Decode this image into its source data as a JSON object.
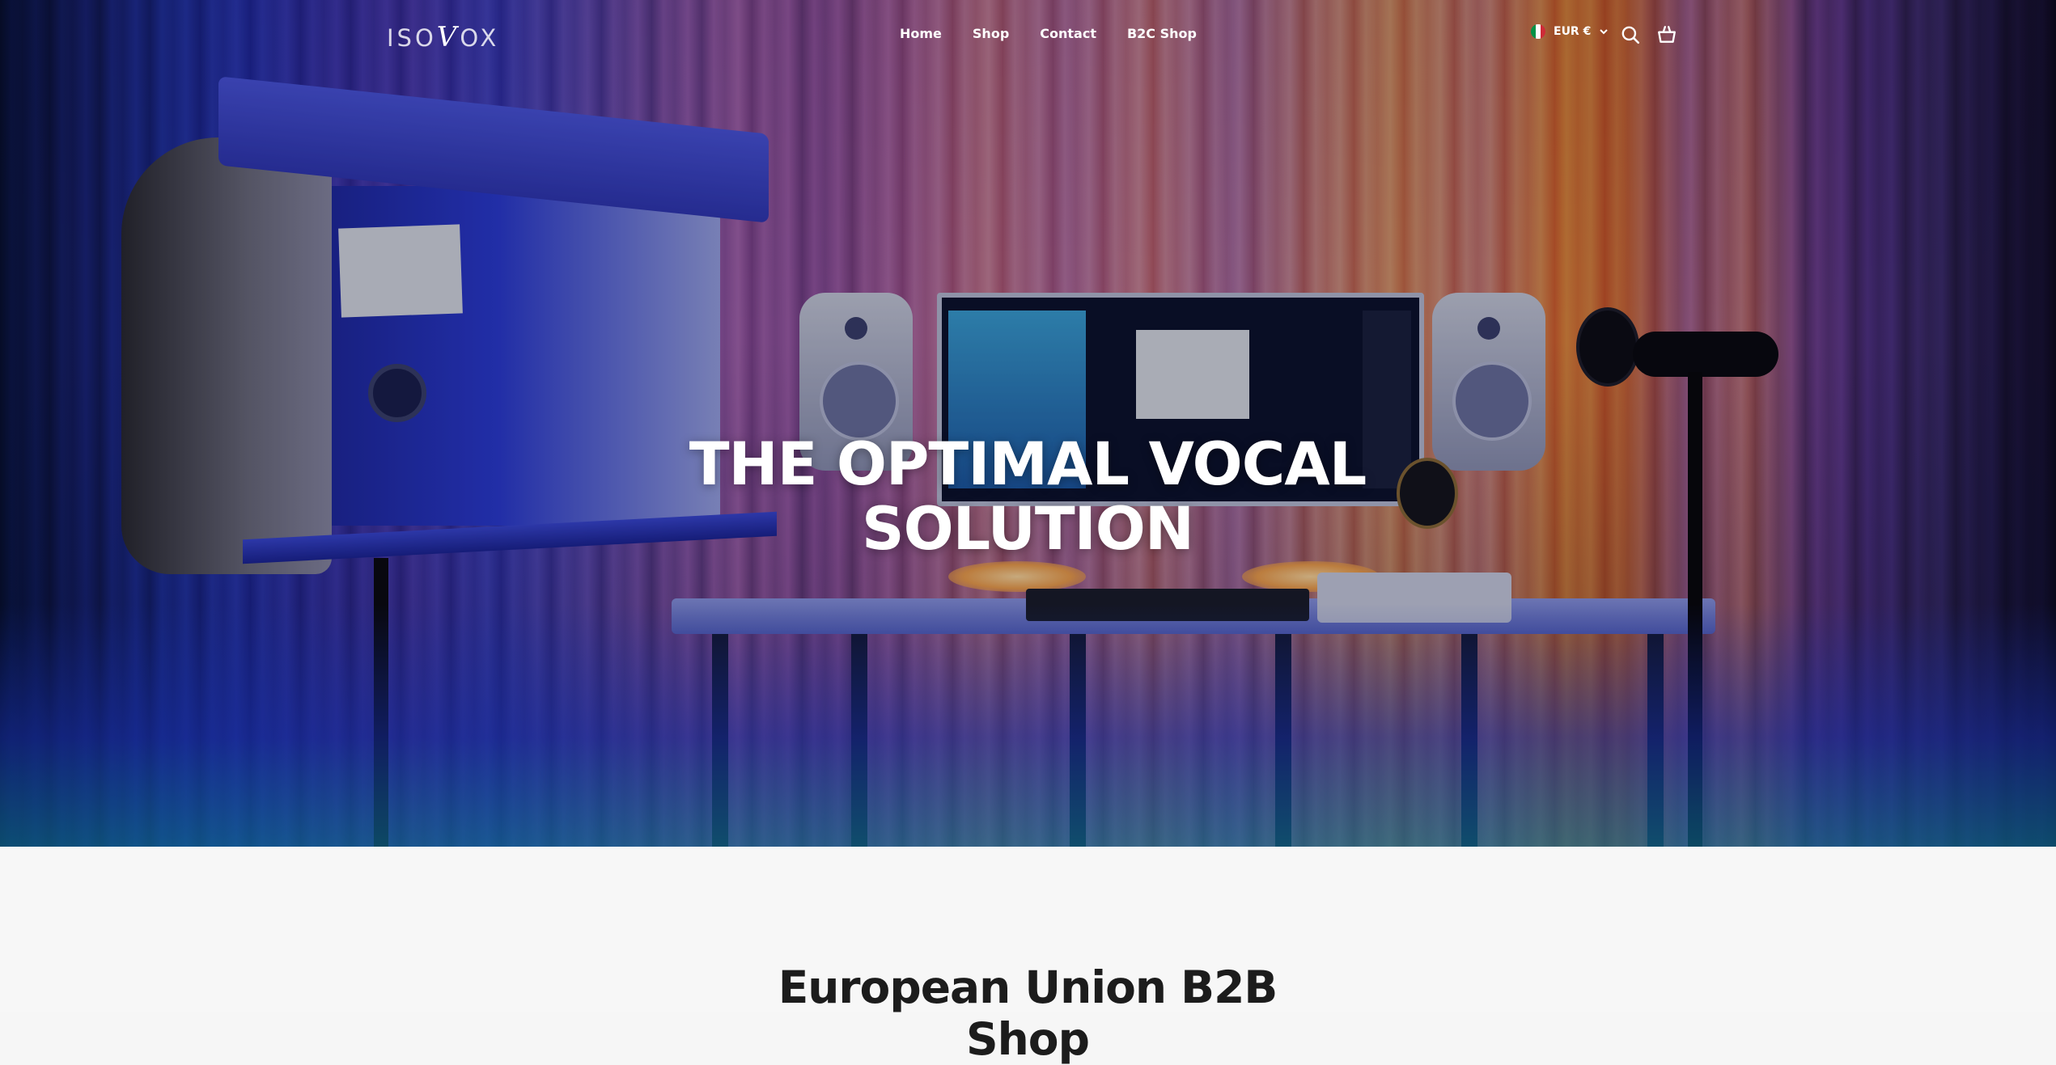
{
  "header": {
    "logo_text": "ISOVOX",
    "nav": [
      {
        "label": "Home"
      },
      {
        "label": "Shop"
      },
      {
        "label": "Contact"
      },
      {
        "label": "B2C Shop"
      }
    ],
    "currency": {
      "label": "EUR €",
      "flag_colors": [
        "#009246",
        "#ffffff",
        "#ce2b37"
      ]
    },
    "icons": [
      "search-icon",
      "cart-icon"
    ]
  },
  "hero": {
    "title_line1": "THE OPTIMAL VOCAL",
    "title_line2": "SOLUTION"
  },
  "section": {
    "title_line1": "European Union B2B",
    "title_line2": "Shop"
  },
  "colors": {
    "text_dark": "#1c1c1c",
    "hero_text": "#ffffff",
    "page_bg": "#f7f7f7"
  }
}
